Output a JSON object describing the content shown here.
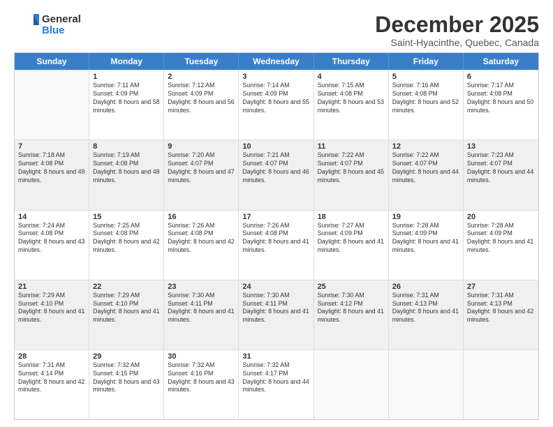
{
  "logo": {
    "general": "General",
    "blue": "Blue"
  },
  "title": "December 2025",
  "subtitle": "Saint-Hyacinthe, Quebec, Canada",
  "days_of_week": [
    "Sunday",
    "Monday",
    "Tuesday",
    "Wednesday",
    "Thursday",
    "Friday",
    "Saturday"
  ],
  "weeks": [
    [
      {
        "day": "",
        "empty": true
      },
      {
        "day": "1",
        "sunrise": "7:11 AM",
        "sunset": "4:09 PM",
        "daylight": "8 hours and 58 minutes."
      },
      {
        "day": "2",
        "sunrise": "7:12 AM",
        "sunset": "4:09 PM",
        "daylight": "8 hours and 56 minutes."
      },
      {
        "day": "3",
        "sunrise": "7:14 AM",
        "sunset": "4:09 PM",
        "daylight": "8 hours and 55 minutes."
      },
      {
        "day": "4",
        "sunrise": "7:15 AM",
        "sunset": "4:08 PM",
        "daylight": "8 hours and 53 minutes."
      },
      {
        "day": "5",
        "sunrise": "7:16 AM",
        "sunset": "4:08 PM",
        "daylight": "8 hours and 52 minutes."
      },
      {
        "day": "6",
        "sunrise": "7:17 AM",
        "sunset": "4:08 PM",
        "daylight": "8 hours and 50 minutes."
      }
    ],
    [
      {
        "day": "7",
        "sunrise": "7:18 AM",
        "sunset": "4:08 PM",
        "daylight": "8 hours and 49 minutes."
      },
      {
        "day": "8",
        "sunrise": "7:19 AM",
        "sunset": "4:08 PM",
        "daylight": "8 hours and 48 minutes."
      },
      {
        "day": "9",
        "sunrise": "7:20 AM",
        "sunset": "4:07 PM",
        "daylight": "8 hours and 47 minutes."
      },
      {
        "day": "10",
        "sunrise": "7:21 AM",
        "sunset": "4:07 PM",
        "daylight": "8 hours and 46 minutes."
      },
      {
        "day": "11",
        "sunrise": "7:22 AM",
        "sunset": "4:07 PM",
        "daylight": "8 hours and 45 minutes."
      },
      {
        "day": "12",
        "sunrise": "7:22 AM",
        "sunset": "4:07 PM",
        "daylight": "8 hours and 44 minutes."
      },
      {
        "day": "13",
        "sunrise": "7:23 AM",
        "sunset": "4:07 PM",
        "daylight": "8 hours and 44 minutes."
      }
    ],
    [
      {
        "day": "14",
        "sunrise": "7:24 AM",
        "sunset": "4:08 PM",
        "daylight": "8 hours and 43 minutes."
      },
      {
        "day": "15",
        "sunrise": "7:25 AM",
        "sunset": "4:08 PM",
        "daylight": "8 hours and 42 minutes."
      },
      {
        "day": "16",
        "sunrise": "7:26 AM",
        "sunset": "4:08 PM",
        "daylight": "8 hours and 42 minutes."
      },
      {
        "day": "17",
        "sunrise": "7:26 AM",
        "sunset": "4:08 PM",
        "daylight": "8 hours and 41 minutes."
      },
      {
        "day": "18",
        "sunrise": "7:27 AM",
        "sunset": "4:09 PM",
        "daylight": "8 hours and 41 minutes."
      },
      {
        "day": "19",
        "sunrise": "7:28 AM",
        "sunset": "4:09 PM",
        "daylight": "8 hours and 41 minutes."
      },
      {
        "day": "20",
        "sunrise": "7:28 AM",
        "sunset": "4:09 PM",
        "daylight": "8 hours and 41 minutes."
      }
    ],
    [
      {
        "day": "21",
        "sunrise": "7:29 AM",
        "sunset": "4:10 PM",
        "daylight": "8 hours and 41 minutes."
      },
      {
        "day": "22",
        "sunrise": "7:29 AM",
        "sunset": "4:10 PM",
        "daylight": "8 hours and 41 minutes."
      },
      {
        "day": "23",
        "sunrise": "7:30 AM",
        "sunset": "4:11 PM",
        "daylight": "8 hours and 41 minutes."
      },
      {
        "day": "24",
        "sunrise": "7:30 AM",
        "sunset": "4:11 PM",
        "daylight": "8 hours and 41 minutes."
      },
      {
        "day": "25",
        "sunrise": "7:30 AM",
        "sunset": "4:12 PM",
        "daylight": "8 hours and 41 minutes."
      },
      {
        "day": "26",
        "sunrise": "7:31 AM",
        "sunset": "4:13 PM",
        "daylight": "8 hours and 41 minutes."
      },
      {
        "day": "27",
        "sunrise": "7:31 AM",
        "sunset": "4:13 PM",
        "daylight": "8 hours and 42 minutes."
      }
    ],
    [
      {
        "day": "28",
        "sunrise": "7:31 AM",
        "sunset": "4:14 PM",
        "daylight": "8 hours and 42 minutes."
      },
      {
        "day": "29",
        "sunrise": "7:32 AM",
        "sunset": "4:15 PM",
        "daylight": "8 hours and 43 minutes."
      },
      {
        "day": "30",
        "sunrise": "7:32 AM",
        "sunset": "4:16 PM",
        "daylight": "8 hours and 43 minutes."
      },
      {
        "day": "31",
        "sunrise": "7:32 AM",
        "sunset": "4:17 PM",
        "daylight": "8 hours and 44 minutes."
      },
      {
        "day": "",
        "empty": true
      },
      {
        "day": "",
        "empty": true
      },
      {
        "day": "",
        "empty": true
      }
    ]
  ]
}
